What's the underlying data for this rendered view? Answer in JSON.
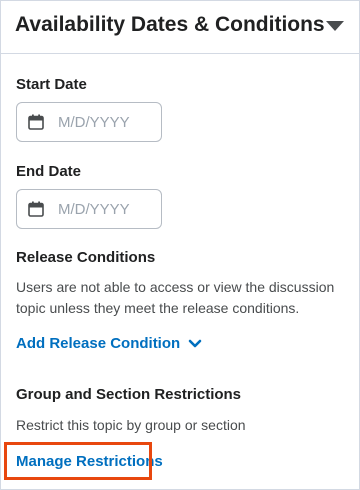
{
  "panel": {
    "title": "Availability Dates & Conditions",
    "collapse_icon": "caret-down-icon"
  },
  "start_date": {
    "label": "Start Date",
    "placeholder": "M/D/YYYY",
    "value": "",
    "icon": "calendar-icon"
  },
  "end_date": {
    "label": "End Date",
    "placeholder": "M/D/YYYY",
    "value": "",
    "icon": "calendar-icon"
  },
  "release_conditions": {
    "heading": "Release Conditions",
    "description": "Users are not able to access or view the discussion topic unless they meet the release conditions.",
    "add_label": "Add Release Condition",
    "add_icon": "chevron-down-icon"
  },
  "restrictions": {
    "heading": "Group and Section Restrictions",
    "description": "Restrict this topic by group or section",
    "manage_label": "Manage Restrictions"
  },
  "colors": {
    "link": "#006fbf",
    "highlight": "#e8470e",
    "border": "#d3d9e3"
  }
}
